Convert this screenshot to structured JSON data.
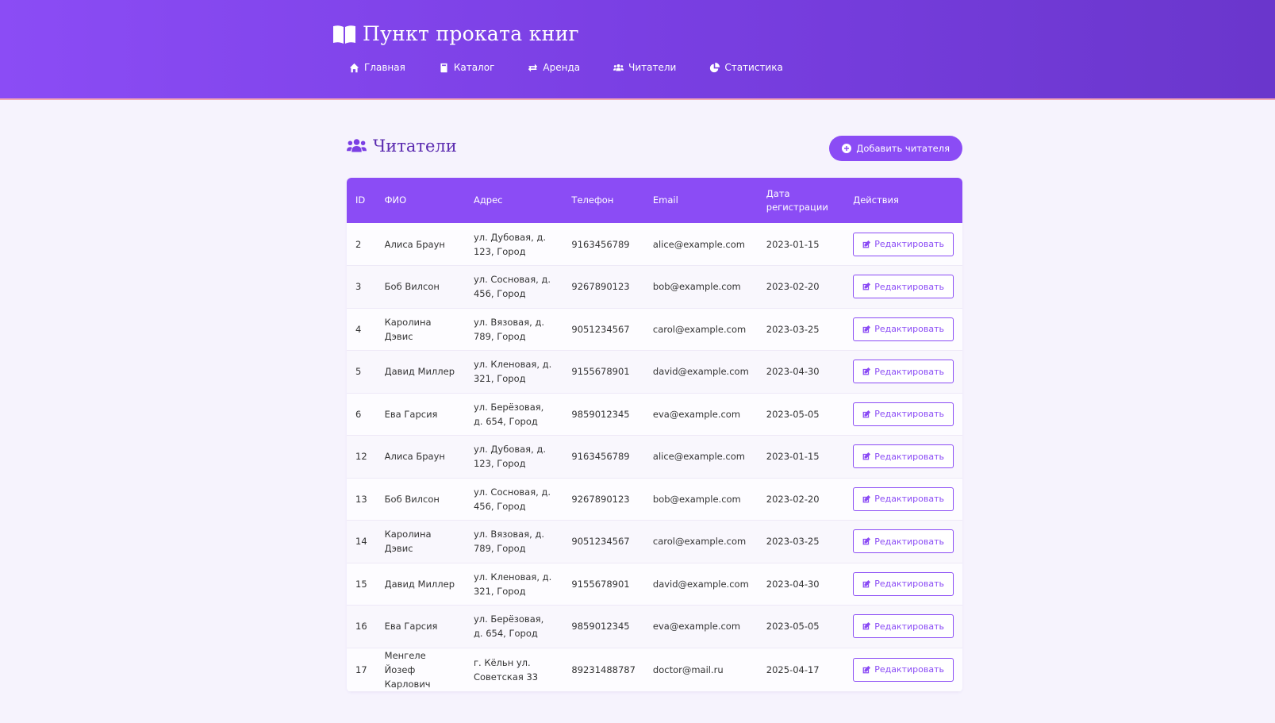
{
  "app": {
    "title": "Пункт проката книг",
    "logo_icon": "book-open-icon"
  },
  "nav": [
    {
      "label": "Главная",
      "icon": "home-icon"
    },
    {
      "label": "Каталог",
      "icon": "book-icon"
    },
    {
      "label": "Аренда",
      "icon": "exchange-icon"
    },
    {
      "label": "Читатели",
      "icon": "users-icon"
    },
    {
      "label": "Статистика",
      "icon": "chart-pie-icon"
    }
  ],
  "page": {
    "title": "Читатели",
    "add_button": "Добавить читателя"
  },
  "table": {
    "headers": [
      "ID",
      "ФИО",
      "Адрес",
      "Телефон",
      "Email",
      "Дата регистрации",
      "Действия"
    ],
    "edit_label": "Редактировать",
    "rows": [
      {
        "id": "2",
        "name": "Алиса Браун",
        "address": "ул. Дубовая, д. 123, Город",
        "phone": "9163456789",
        "email": "alice@example.com",
        "date": "2023-01-15"
      },
      {
        "id": "3",
        "name": "Боб Вилсон",
        "address": "ул. Сосновая, д. 456, Город",
        "phone": "9267890123",
        "email": "bob@example.com",
        "date": "2023-02-20"
      },
      {
        "id": "4",
        "name": "Каролина Дэвис",
        "address": "ул. Вязовая, д. 789, Город",
        "phone": "9051234567",
        "email": "carol@example.com",
        "date": "2023-03-25"
      },
      {
        "id": "5",
        "name": "Давид Миллер",
        "address": "ул. Кленовая, д. 321, Город",
        "phone": "9155678901",
        "email": "david@example.com",
        "date": "2023-04-30"
      },
      {
        "id": "6",
        "name": "Ева Гарсия",
        "address": "ул. Берёзовая, д. 654, Город",
        "phone": "9859012345",
        "email": "eva@example.com",
        "date": "2023-05-05"
      },
      {
        "id": "12",
        "name": "Алиса Браун",
        "address": "ул. Дубовая, д. 123, Город",
        "phone": "9163456789",
        "email": "alice@example.com",
        "date": "2023-01-15"
      },
      {
        "id": "13",
        "name": "Боб Вилсон",
        "address": "ул. Сосновая, д. 456, Город",
        "phone": "9267890123",
        "email": "bob@example.com",
        "date": "2023-02-20"
      },
      {
        "id": "14",
        "name": "Каролина Дэвис",
        "address": "ул. Вязовая, д. 789, Город",
        "phone": "9051234567",
        "email": "carol@example.com",
        "date": "2023-03-25"
      },
      {
        "id": "15",
        "name": "Давид Миллер",
        "address": "ул. Кленовая, д. 321, Город",
        "phone": "9155678901",
        "email": "david@example.com",
        "date": "2023-04-30"
      },
      {
        "id": "16",
        "name": "Ева Гарсия",
        "address": "ул. Берёзовая, д. 654, Город",
        "phone": "9859012345",
        "email": "eva@example.com",
        "date": "2023-05-05"
      },
      {
        "id": "17",
        "name": "Менгеле Йозеф Карлович",
        "address": "г. Кёльн ул. Советская 33",
        "phone": "89231488787",
        "email": "doctor@mail.ru",
        "date": "2025-04-17"
      }
    ]
  },
  "colors": {
    "accent": "#8b4cf5",
    "title": "#5b2bb0",
    "background": "#f6f3fd"
  }
}
